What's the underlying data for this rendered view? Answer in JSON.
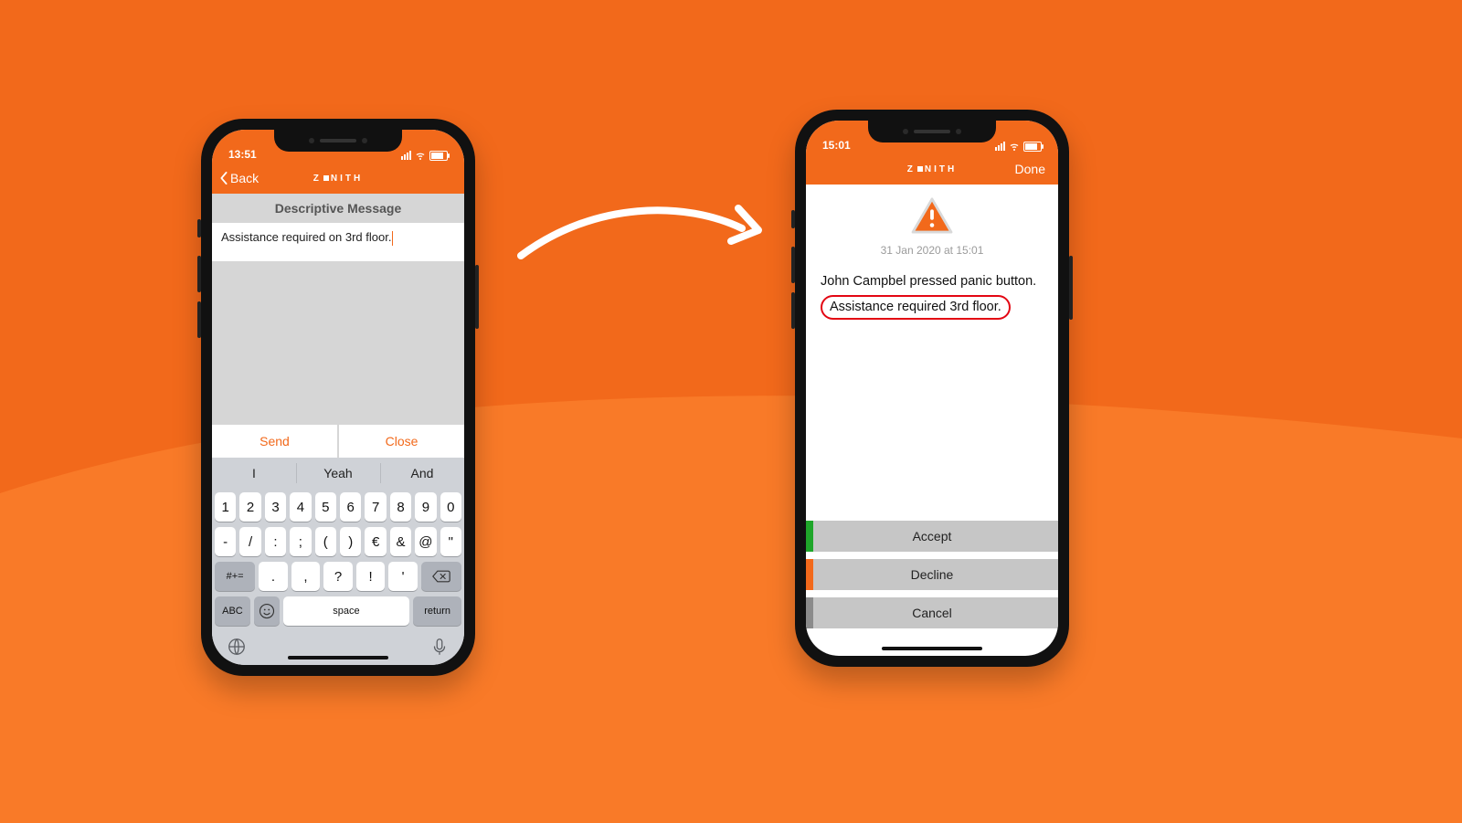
{
  "left": {
    "time": "13:51",
    "back_label": "Back",
    "brand": "Z  NITH",
    "section_title": "Descriptive Message",
    "compose_text": "Assistance required on 3rd floor.",
    "send_label": "Send",
    "close_label": "Close",
    "predictions": [
      "I",
      "Yeah",
      "And"
    ],
    "row1": [
      "1",
      "2",
      "3",
      "4",
      "5",
      "6",
      "7",
      "8",
      "9",
      "0"
    ],
    "row2": [
      "-",
      "/",
      ":",
      ";",
      "(",
      ")",
      "€",
      "&",
      "@",
      "\""
    ],
    "row3_shift": "#+=",
    "row3": [
      ".",
      ",",
      "?",
      "!",
      "'"
    ],
    "row4_abc": "ABC",
    "space_label": "space",
    "return_label": "return"
  },
  "right": {
    "time": "15:01",
    "brand": "Z  NITH",
    "done_label": "Done",
    "timestamp": "31 Jan 2020 at 15:01",
    "alert_line1": "John Campbel pressed panic button.",
    "alert_highlight": "Assistance required 3rd floor.",
    "accept_label": "Accept",
    "decline_label": "Decline",
    "cancel_label": "Cancel"
  }
}
